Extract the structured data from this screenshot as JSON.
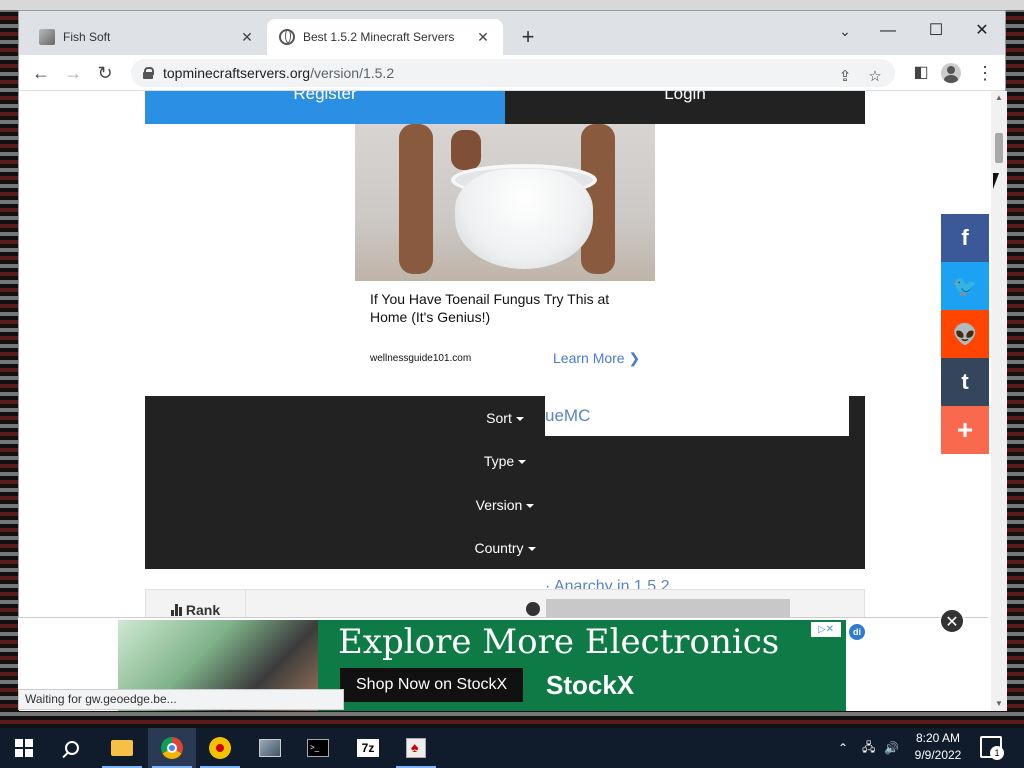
{
  "browser": {
    "tabs": [
      {
        "title": "Fish Soft",
        "close": "✕"
      },
      {
        "title": "Best 1.5.2 Minecraft Servers",
        "close": "✕"
      }
    ],
    "new_tab": "+",
    "tab_search": "⌄",
    "window_controls": {
      "minimize": "—",
      "maximize": "☐",
      "close": "✕"
    },
    "nav": {
      "back": "←",
      "forward": "→",
      "reload": "↻"
    },
    "url": {
      "host": "topminecraftservers.org",
      "path": "/version/1.5.2"
    },
    "omni_actions": {
      "share": "⇪",
      "bookmark": "☆",
      "sidepanel": "◧",
      "menu": "⋮"
    }
  },
  "page": {
    "auth": {
      "register": "Register",
      "login": "Login"
    },
    "ad": {
      "headline": "If You Have Toenail Fungus Try This at Home (It's Genius!)",
      "source": "wellnessguide101.com",
      "cta": "Learn More ❯"
    },
    "filters": {
      "search_value": "ueMC",
      "sort": "Sort",
      "type": "Type",
      "version": "Version",
      "country": "Country"
    },
    "anarchy_text": "· Anarchy in 1.5.2",
    "table": {
      "rank_header": "Rank"
    }
  },
  "share": [
    {
      "name": "facebook",
      "glyph": "f",
      "color": "#3b5998"
    },
    {
      "name": "twitter",
      "glyph": "🐦",
      "color": "#1da1f2"
    },
    {
      "name": "reddit",
      "glyph": "👽",
      "color": "#ff4500"
    },
    {
      "name": "tumblr",
      "glyph": "t",
      "color": "#35465c"
    },
    {
      "name": "more",
      "glyph": "+",
      "color": "#f8694d"
    }
  ],
  "bottom_ad": {
    "headline": "Explore More Electronics",
    "cta": "Shop Now on StockX",
    "brand": "StockX",
    "choices": "▷✕",
    "close": "✕",
    "di": "di"
  },
  "status": "Waiting for gw.geoedge.be...",
  "taskbar": {
    "time": "8:20 AM",
    "date": "9/9/2022",
    "notification_count": "1"
  }
}
